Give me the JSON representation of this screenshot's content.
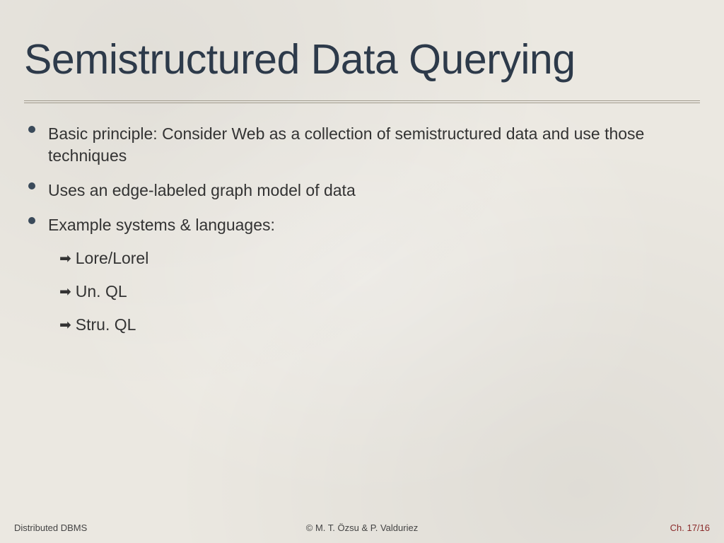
{
  "title": "Semistructured Data Querying",
  "bullets": [
    {
      "text": "Basic principle: Consider Web as a collection of semistructured data and use those techniques"
    },
    {
      "text": "Uses an edge-labeled graph model of data"
    },
    {
      "text": "Example systems & languages:"
    }
  ],
  "subitems": [
    {
      "text": "Lore/Lorel"
    },
    {
      "text": "Un. QL"
    },
    {
      "text": "Stru. QL"
    }
  ],
  "footer": {
    "left": "Distributed DBMS",
    "center": "© M. T. Özsu & P. Valduriez",
    "right": "Ch. 17/16"
  }
}
